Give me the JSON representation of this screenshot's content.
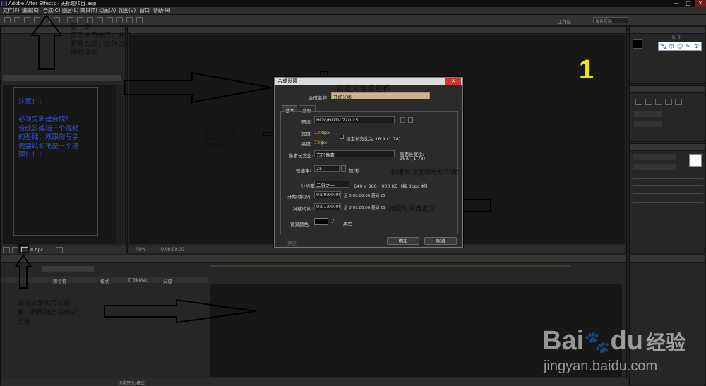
{
  "window": {
    "title": "Adobe After Effects - 无标题项目.aep",
    "minimize": "—",
    "maximize": "□",
    "close": "✕"
  },
  "menu": [
    "文件(F)",
    "编辑(E)",
    "合成(C)",
    "图层(L)",
    "效果(T)",
    "动画(A)",
    "视图(V)",
    "窗口",
    "帮助(H)"
  ],
  "toolbar": {
    "workspace_label": "工作区",
    "search_placeholder": "搜索帮助"
  },
  "project_panel": {
    "bpc": "8 bpc",
    "bottom_zoom": "50%",
    "bottom_time": "0:00:00:00"
  },
  "right_panel": {
    "tools": [
      "🐾",
      "中",
      "☺",
      "✎",
      "⚙"
    ],
    "info_value": "R: 0",
    "big_number": "1"
  },
  "timeline": {
    "col_name": "源名称",
    "col_mode": "模式",
    "col_trk": "T   TrkMat",
    "col_parent": "父级",
    "bottom_label": "切换开关/模式"
  },
  "dialog": {
    "title": "合成设置",
    "close": "✕",
    "name_label": "合成名称:",
    "name_value": "开场光线",
    "tab_basic": "基本",
    "tab_advanced": "高级",
    "preset_label": "预设:",
    "preset_value": "HDV/HDTV 720 25",
    "width_label": "宽度:",
    "width_value": "1280",
    "width_unit": "px",
    "lock_label": "锁定长宽比为 16:9 (1.78)",
    "height_label": "高度:",
    "height_value": "720",
    "height_unit": "px",
    "par_label": "像素长宽比:",
    "par_value": "方形像素",
    "frame_ar_label": "画面长宽比:",
    "frame_ar_value": "16:9 (1.78)",
    "fps_label": "帧速率:",
    "fps_value": "25",
    "fps_unit": "帧/秒",
    "res_label": "分辨率:",
    "res_value": "二分之一",
    "res_info": "640 x 360，900 KB（每 8bpc 帧）",
    "start_label": "开始时间码:",
    "start_value": "0:00:00:00",
    "start_info": "是 0:00:00:00   基础 25",
    "dur_label": "持续时间:",
    "dur_value": "0:01:00:00",
    "dur_info": "是 0:01:00:00   基础 25",
    "bg_label": "背景颜色:",
    "bg_name": "黑色",
    "preview": "预览",
    "ok": "确定",
    "cancel": "取消"
  },
  "annotations": {
    "step1": "第一步：\n首先点击合成，点击\n新建合成，会弹出右\n侧对话框",
    "notice": "注意！！！\n\n必须先新建合成！\n合成是编辑一个视频\n的基础，就跟你写字\n需要纸和笔是一个道\n理！！！！",
    "custom_name": "自定义合成名称",
    "size_note": "根据自己的需要，设置\n合成的宽高比，常用的\n就是1280*720",
    "fps_note": "帧速率设置成每秒25帧",
    "duration_note": "持续时间自定义",
    "click_note": "单击这里也可以新\n建，同样弹出右侧对\n话框"
  },
  "watermark": {
    "brand": "Bai",
    "brand2": "du",
    "jingyan": "经验",
    "url": "jingyan.baidu.com"
  },
  "colors": {
    "annotation_red": "#b0103a",
    "annotation_blue": "#3a52d8",
    "yellow": "#f2e21c",
    "accent_orange": "#e8a23c"
  }
}
